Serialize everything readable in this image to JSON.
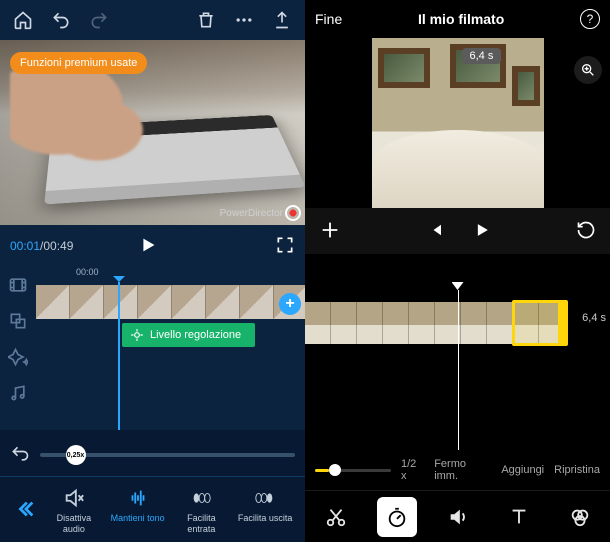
{
  "left": {
    "premium_badge": "Funzioni premium usate",
    "brand": "PowerDirector",
    "time": {
      "current": "00:01",
      "sep": "/",
      "duration": "00:49"
    },
    "ruler_label": "00:00",
    "adjustment_layer": "Livello regolazione",
    "speed": {
      "value_label": "0,25x"
    },
    "options": {
      "mute": {
        "label": "Disattiva\naudio"
      },
      "pitch": {
        "label": "Mantieni tono"
      },
      "easein": {
        "label": "Facilita\nentrata"
      },
      "easeout": {
        "label": "Facilita uscita"
      }
    }
  },
  "right": {
    "done": "Fine",
    "title": "Il mio filmato",
    "duration_chip": "6,4 s",
    "timeline_duration": "6,4 s",
    "speedbar": {
      "ratio": "1/2 x",
      "freeze": "Fermo imm.",
      "add": "Aggiungi",
      "reset": "Ripristina"
    }
  }
}
